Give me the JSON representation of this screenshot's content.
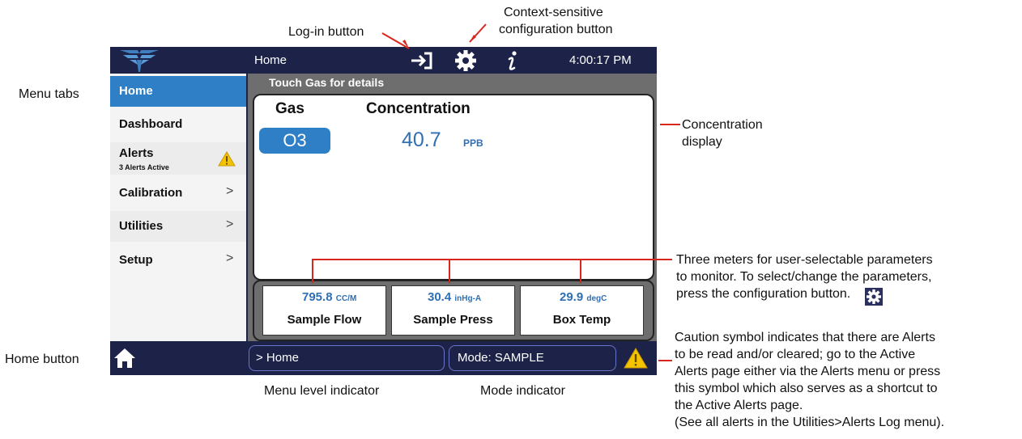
{
  "device": {
    "topbar": {
      "title": "Home",
      "clock": "4:00:17 PM"
    },
    "sidebar": {
      "items": [
        {
          "label": "Home",
          "active": true
        },
        {
          "label": "Dashboard"
        },
        {
          "label": "Alerts",
          "sub": "3 Alerts Active",
          "icon": "warning-icon"
        },
        {
          "label": "Calibration",
          "chevron": ">"
        },
        {
          "label": "Utilities",
          "chevron": ">"
        },
        {
          "label": "Setup",
          "chevron": ">"
        }
      ]
    },
    "main": {
      "hint": "Touch Gas for details",
      "header_gas": "Gas",
      "header_concentration": "Concentration",
      "gas_name": "O3",
      "concentration_value": "40.7",
      "concentration_unit": "PPB",
      "meters": [
        {
          "value": "795.8",
          "unit": "CC/M",
          "name": "Sample Flow"
        },
        {
          "value": "30.4",
          "unit": "inHg-A",
          "name": "Sample Press"
        },
        {
          "value": "29.9",
          "unit": "degC",
          "name": "Box Temp"
        }
      ]
    },
    "bottombar": {
      "menu_level": "> Home",
      "mode": "Mode: SAMPLE"
    }
  },
  "annotations": {
    "login": "Log-in button",
    "config_line1": "Context-sensitive",
    "config_line2": "configuration button",
    "menu_tabs": "Menu tabs",
    "home_button": "Home button",
    "concentration_line1": "Concentration",
    "concentration_line2": "display",
    "meters_line1": "Three meters for user-selectable parameters",
    "meters_line2": "to monitor. To select/change the parameters,",
    "meters_line3": "press the configuration button.",
    "caution_line1": "Caution symbol indicates that there are Alerts",
    "caution_line2": "to be read and/or cleared; go to the Active",
    "caution_line3": "Alerts page either via the Alerts menu or press",
    "caution_line4": "this symbol which also serves as a shortcut to",
    "caution_line5": "the Active Alerts page.",
    "caution_line6": "(See all alerts in the Utilities>Alerts Log menu).",
    "menu_level": "Menu level indicator",
    "mode": "Mode indicator"
  },
  "colors": {
    "navy": "#1d2348",
    "accent_blue": "#2f7fc7",
    "value_blue": "#2f6fb3",
    "callout_red": "#d9261c",
    "warning_yellow": "#f5c400"
  }
}
